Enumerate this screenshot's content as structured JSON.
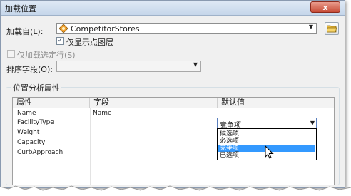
{
  "window": {
    "title": "加载位置",
    "close_label": "x"
  },
  "load_from": {
    "label": "加载自(L):",
    "value": "CompetitorStores",
    "icon": "layer-diamond-icon"
  },
  "show_point_layers_only": {
    "label": "仅显示点图层",
    "checked": true
  },
  "load_selected_rows": {
    "label": "仅加载选定行(S)",
    "checked": false,
    "enabled": false
  },
  "sort_field": {
    "label": "排序字段(O):",
    "value": ""
  },
  "location_analysis": {
    "group_label": "位置分析属性",
    "columns": [
      "属性",
      "字段",
      "默认值"
    ],
    "rows": [
      {
        "property": "Name",
        "field": "Name",
        "default": ""
      },
      {
        "property": "FacilityType",
        "field": "",
        "default": "竞争项"
      },
      {
        "property": "Weight",
        "field": "",
        "default": ""
      },
      {
        "property": "Capacity",
        "field": "",
        "default": ""
      },
      {
        "property": "CurbApproach",
        "field": "",
        "default": ""
      }
    ],
    "dropdown": {
      "selected": "竞争项",
      "options": [
        "候选项",
        "必选项",
        "竞争项",
        "已选项"
      ],
      "highlighted_index": 2
    }
  },
  "colors": {
    "highlight": "#3399ff",
    "close": "#c74b36",
    "titlebar": "#c5d6ea"
  }
}
